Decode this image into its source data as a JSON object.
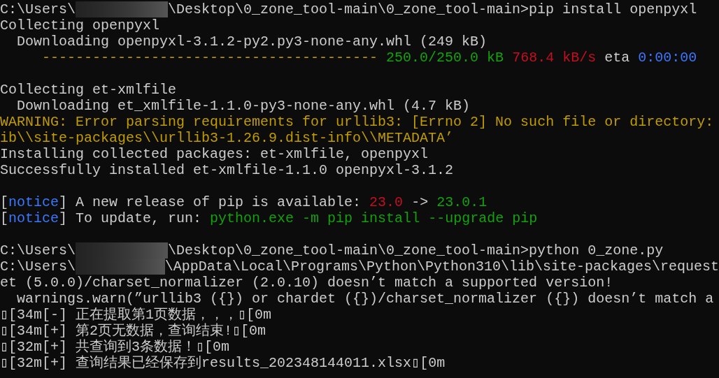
{
  "lines": [
    {
      "kind": "text",
      "segments": [
        {
          "kind": "plain",
          "text": "C:\\Users\\"
        },
        {
          "kind": "redacted"
        },
        {
          "kind": "plain",
          "text": "\\Desktop\\0_zone_tool-main\\0_zone_tool-main>pip install openpyxl"
        }
      ]
    },
    {
      "kind": "text",
      "segments": [
        {
          "kind": "plain",
          "text": "Collecting openpyxl"
        }
      ]
    },
    {
      "kind": "text",
      "segments": [
        {
          "kind": "plain",
          "text": "  Downloading openpyxl-3.1.2-py2.py3-none-any.whl (249 kB)"
        }
      ]
    },
    {
      "kind": "text",
      "segments": [
        {
          "kind": "yellow",
          "text": "     ----------------------------------------"
        },
        {
          "kind": "green",
          "text": " 250.0/250.0 kB"
        },
        {
          "kind": "red",
          "text": " 768.4 kB/s"
        },
        {
          "kind": "plain",
          "text": " eta "
        },
        {
          "kind": "blue",
          "text": "0:00:00"
        }
      ]
    },
    {
      "kind": "blank"
    },
    {
      "kind": "text",
      "segments": [
        {
          "kind": "plain",
          "text": "Collecting et-xmlfile"
        }
      ]
    },
    {
      "kind": "text",
      "segments": [
        {
          "kind": "plain",
          "text": "  Downloading et_xmlfile-1.1.0-py3-none-any.whl (4.7 kB)"
        }
      ]
    },
    {
      "kind": "text",
      "segments": [
        {
          "kind": "yellow",
          "text": "WARNING: Error parsing requirements for urllib3: [Errno 2] No such file or directory:"
        }
      ]
    },
    {
      "kind": "text",
      "segments": [
        {
          "kind": "yellow",
          "text": "ib\\\\site-packages\\\\urllib3-1.26.9.dist-info\\\\METADATA’"
        }
      ]
    },
    {
      "kind": "text",
      "segments": [
        {
          "kind": "plain",
          "text": "Installing collected packages: et-xmlfile, openpyxl"
        }
      ]
    },
    {
      "kind": "text",
      "segments": [
        {
          "kind": "plain",
          "text": "Successfully installed et-xmlfile-1.1.0 openpyxl-3.1.2"
        }
      ]
    },
    {
      "kind": "blank"
    },
    {
      "kind": "text",
      "segments": [
        {
          "kind": "plain",
          "text": "["
        },
        {
          "kind": "blue",
          "text": "notice"
        },
        {
          "kind": "plain",
          "text": "] A new release of pip is available: "
        },
        {
          "kind": "red",
          "text": "23.0"
        },
        {
          "kind": "plain",
          "text": " -> "
        },
        {
          "kind": "green",
          "text": "23.0.1"
        }
      ]
    },
    {
      "kind": "text",
      "segments": [
        {
          "kind": "plain",
          "text": "["
        },
        {
          "kind": "blue",
          "text": "notice"
        },
        {
          "kind": "plain",
          "text": "] To update, run: "
        },
        {
          "kind": "green",
          "text": "python.exe -m pip install --upgrade pip"
        }
      ]
    },
    {
      "kind": "blank"
    },
    {
      "kind": "text",
      "segments": [
        {
          "kind": "plain",
          "text": "C:\\Users\\"
        },
        {
          "kind": "redacted"
        },
        {
          "kind": "plain",
          "text": "\\Desktop\\0_zone_tool-main\\0_zone_tool-main>python 0_zone.py"
        }
      ]
    },
    {
      "kind": "text",
      "segments": [
        {
          "kind": "plain",
          "text": "C:\\Users\\"
        },
        {
          "kind": "redacted"
        },
        {
          "kind": "plain",
          "text": "\\AppData\\Local\\Programs\\Python\\Python310\\lib\\site-packages\\request"
        }
      ]
    },
    {
      "kind": "text",
      "segments": [
        {
          "kind": "plain",
          "text": "et (5.0.0)/charset_normalizer (2.0.10) doesn’t match a supported version!"
        }
      ]
    },
    {
      "kind": "text",
      "segments": [
        {
          "kind": "plain",
          "text": "  warnings.warn(”urllib3 ({}) or chardet ({})/charset_normalizer ({}) doesn’t match a"
        }
      ]
    },
    {
      "kind": "text",
      "segments": [
        {
          "kind": "plain",
          "text": "▯[34m[-] 正在提取第1页数据，，，▯[0m"
        }
      ]
    },
    {
      "kind": "text",
      "segments": [
        {
          "kind": "plain",
          "text": "▯[34m[+] 第2页无数据，查询结束!▯[0m"
        }
      ]
    },
    {
      "kind": "text",
      "segments": [
        {
          "kind": "plain",
          "text": "▯[32m[+] 共查询到3条数据！▯[0m"
        }
      ]
    },
    {
      "kind": "text",
      "segments": [
        {
          "kind": "plain",
          "text": "▯[32m[+] 查询结果已经保存到results_202348144011.xlsx▯[0m"
        }
      ]
    }
  ]
}
